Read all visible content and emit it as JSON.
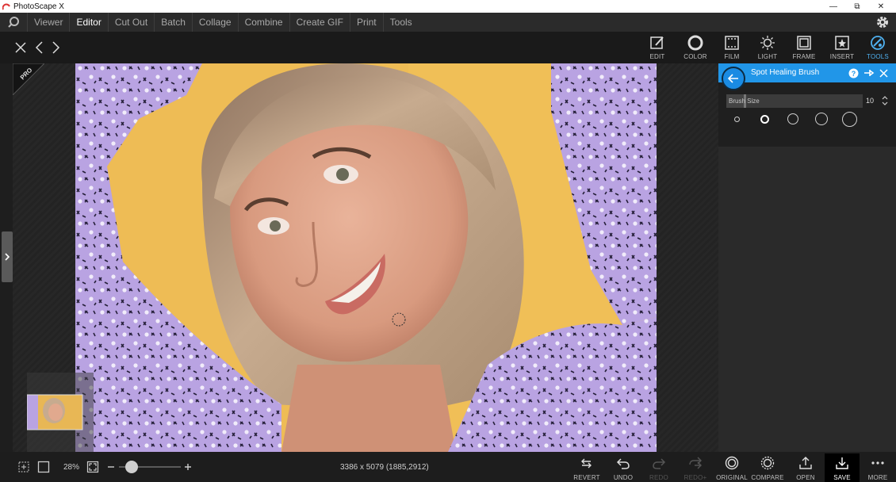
{
  "window": {
    "title": "PhotoScape X",
    "minimize": "—",
    "restore": "⧉",
    "close": "✕"
  },
  "menu": {
    "items": [
      "Viewer",
      "Editor",
      "Cut Out",
      "Batch",
      "Collage",
      "Combine",
      "Create GIF",
      "Print",
      "Tools"
    ],
    "active": "Editor"
  },
  "toolbar": {
    "tools": [
      {
        "label": "EDIT",
        "icon": "edit-icon"
      },
      {
        "label": "COLOR",
        "icon": "color-icon"
      },
      {
        "label": "FILM",
        "icon": "film-icon"
      },
      {
        "label": "LIGHT",
        "icon": "light-icon"
      },
      {
        "label": "FRAME",
        "icon": "frame-icon"
      },
      {
        "label": "INSERT",
        "icon": "insert-icon"
      },
      {
        "label": "TOOLS",
        "icon": "tools-icon"
      }
    ],
    "active_tool": "TOOLS"
  },
  "badge": {
    "text": "PRO"
  },
  "panel": {
    "title": "Spot Healing Brush",
    "brush_size_label": "Brush Size",
    "brush_size_value": "10",
    "brush_size_fraction": 0.14,
    "presets_count_label": "5 brush presets",
    "accent": "#2196e8"
  },
  "status": {
    "zoom": "28%",
    "dimensions": "3386 x 5079 (1885,2912)",
    "zoom_level_fraction": 0.1
  },
  "actions": [
    {
      "label": "REVERT",
      "icon": "revert-icon",
      "enabled": true
    },
    {
      "label": "UNDO",
      "icon": "undo-icon",
      "enabled": true
    },
    {
      "label": "REDO",
      "icon": "redo-icon",
      "enabled": false
    },
    {
      "label": "REDO+",
      "icon": "redo-all-icon",
      "enabled": false
    },
    {
      "label": "ORIGINAL",
      "icon": "original-icon",
      "enabled": true
    },
    {
      "label": "COMPARE",
      "icon": "compare-icon",
      "enabled": true
    },
    {
      "label": "OPEN",
      "icon": "open-icon",
      "enabled": true
    },
    {
      "label": "SAVE",
      "icon": "save-icon",
      "enabled": true
    },
    {
      "label": "MORE",
      "icon": "more-icon",
      "enabled": true
    }
  ]
}
